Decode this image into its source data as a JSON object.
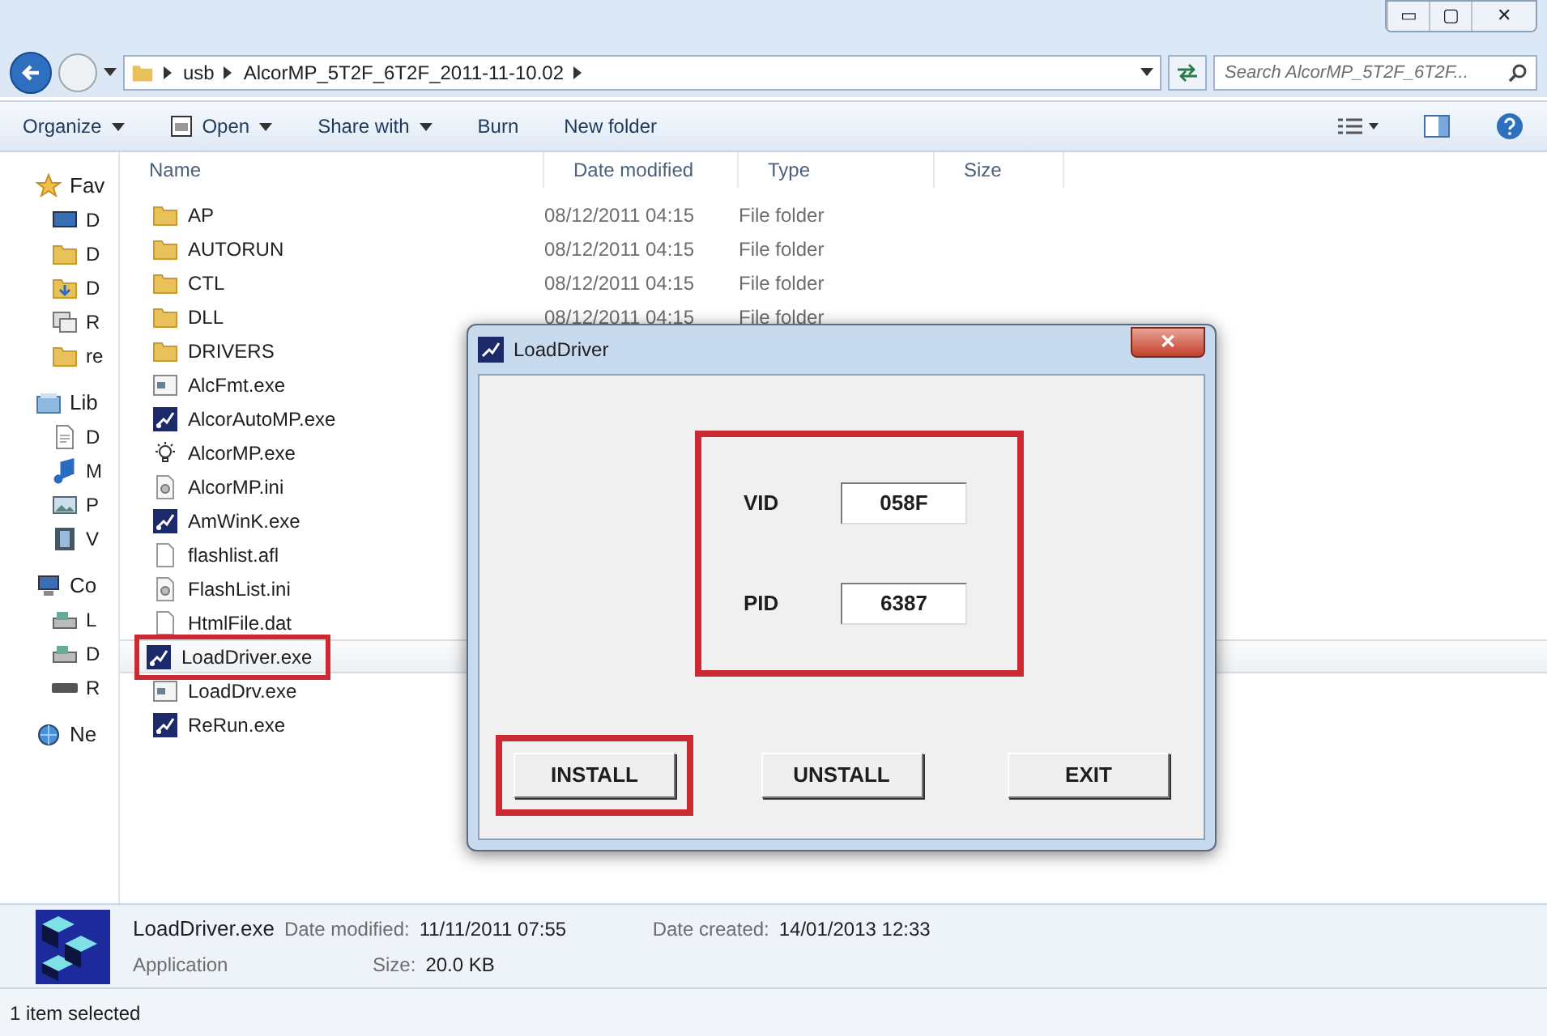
{
  "window": {
    "controls": [
      "▭",
      "▢",
      "✕"
    ]
  },
  "address": {
    "crumbs": [
      "usb",
      "AlcorMP_5T2F_6T2F_2011-11-10.02"
    ],
    "search_placeholder": "Search AlcorMP_5T2F_6T2F..."
  },
  "toolbar": {
    "items": [
      {
        "label": "Organize",
        "dropdown": true,
        "kind": "plain"
      },
      {
        "label": "Open",
        "dropdown": true,
        "kind": "open"
      },
      {
        "label": "Share with",
        "dropdown": true,
        "kind": "plain"
      },
      {
        "label": "Burn",
        "dropdown": false,
        "kind": "plain"
      },
      {
        "label": "New folder",
        "dropdown": false,
        "kind": "plain"
      }
    ]
  },
  "sidebar": {
    "items": [
      {
        "label": "Fav",
        "kind": "star",
        "section": true
      },
      {
        "label": "D",
        "kind": "desktop",
        "section": false
      },
      {
        "label": "D",
        "kind": "folder",
        "section": false
      },
      {
        "label": "D",
        "kind": "download",
        "section": false
      },
      {
        "label": "R",
        "kind": "recent",
        "section": false
      },
      {
        "label": "re",
        "kind": "folder",
        "section": false
      },
      {
        "label": "Lib",
        "kind": "library",
        "section": true
      },
      {
        "label": "D",
        "kind": "document",
        "section": false
      },
      {
        "label": "M",
        "kind": "music",
        "section": false
      },
      {
        "label": "P",
        "kind": "picture",
        "section": false
      },
      {
        "label": "V",
        "kind": "video",
        "section": false
      },
      {
        "label": "Co",
        "kind": "computer",
        "section": true
      },
      {
        "label": "L",
        "kind": "drive",
        "section": false
      },
      {
        "label": "D",
        "kind": "drive",
        "section": false
      },
      {
        "label": "R",
        "kind": "removable",
        "section": false
      },
      {
        "label": "Ne",
        "kind": "network",
        "section": true
      }
    ]
  },
  "table": {
    "columns": [
      "Name",
      "Date modified",
      "Type",
      "Size"
    ],
    "rows": [
      {
        "name": "AP",
        "kind": "folder",
        "date": "08/12/2011 04:15",
        "type": "File folder",
        "selected": false,
        "highlighted": false
      },
      {
        "name": "AUTORUN",
        "kind": "folder",
        "date": "08/12/2011 04:15",
        "type": "File folder",
        "selected": false,
        "highlighted": false
      },
      {
        "name": "CTL",
        "kind": "folder",
        "date": "08/12/2011 04:15",
        "type": "File folder",
        "selected": false,
        "highlighted": false
      },
      {
        "name": "DLL",
        "kind": "folder",
        "date": "08/12/2011 04:15",
        "type": "File folder",
        "selected": false,
        "highlighted": false
      },
      {
        "name": "DRIVERS",
        "kind": "folder",
        "selected": false,
        "highlighted": false
      },
      {
        "name": "AlcFmt.exe",
        "kind": "window-exe",
        "selected": false,
        "highlighted": false
      },
      {
        "name": "AlcorAutoMP.exe",
        "kind": "app",
        "selected": false,
        "highlighted": false
      },
      {
        "name": "AlcorMP.exe",
        "kind": "bulb",
        "selected": false,
        "highlighted": false
      },
      {
        "name": "AlcorMP.ini",
        "kind": "settings",
        "selected": false,
        "highlighted": false
      },
      {
        "name": "AmWinK.exe",
        "kind": "app",
        "selected": false,
        "highlighted": false
      },
      {
        "name": "flashlist.afl",
        "kind": "document",
        "selected": false,
        "highlighted": false
      },
      {
        "name": "FlashList.ini",
        "kind": "settings",
        "selected": false,
        "highlighted": false
      },
      {
        "name": "HtmlFile.dat",
        "kind": "document",
        "selected": false,
        "highlighted": false
      },
      {
        "name": "LoadDriver.exe",
        "kind": "app",
        "selected": true,
        "highlighted": true
      },
      {
        "name": "LoadDrv.exe",
        "kind": "window-exe",
        "selected": false,
        "highlighted": false
      },
      {
        "name": "ReRun.exe",
        "kind": "app",
        "selected": false,
        "highlighted": false
      }
    ]
  },
  "details": {
    "name": "LoadDriver.exe",
    "kind_label": "Application",
    "fields": [
      {
        "label": "Date modified:",
        "value": "11/11/2011 07:55"
      },
      {
        "label": "Date created:",
        "value": "14/01/2013 12:33"
      },
      {
        "label": "Size:",
        "value": "20.0 KB"
      }
    ]
  },
  "status_bar": "1 item selected",
  "dialog": {
    "title": "LoadDriver",
    "close": "✕",
    "fields_highlighted": true,
    "fields": [
      {
        "label": "VID",
        "value": "058F"
      },
      {
        "label": "PID",
        "value": "6387"
      }
    ],
    "buttons": [
      {
        "label": "INSTALL",
        "highlighted": true
      },
      {
        "label": "UNSTALL",
        "highlighted": false
      },
      {
        "label": "EXIT",
        "highlighted": false
      }
    ]
  }
}
